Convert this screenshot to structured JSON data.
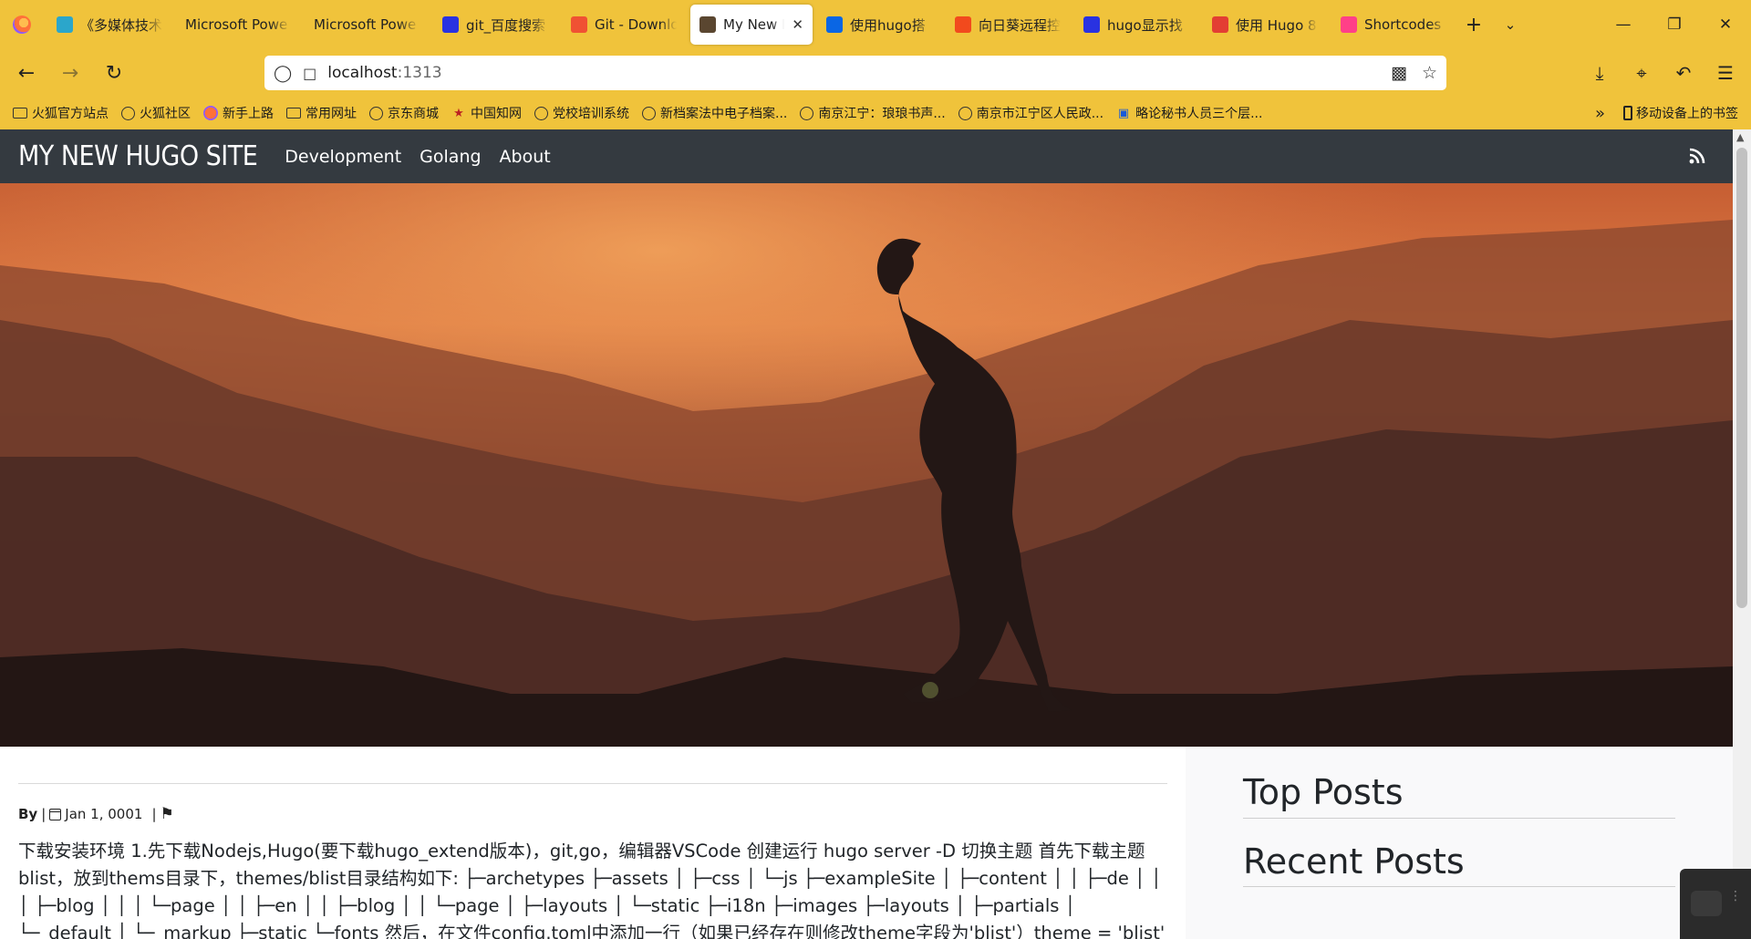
{
  "browser": {
    "tabs": [
      {
        "label": "《多媒体技术",
        "icon": "teal-logo-icon",
        "color": "#2ba6cb"
      },
      {
        "label": "Microsoft Powe",
        "icon": "",
        "color": ""
      },
      {
        "label": "Microsoft Powe",
        "icon": "",
        "color": ""
      },
      {
        "label": "git_百度搜索",
        "icon": "baidu-icon",
        "color": "#2932e1"
      },
      {
        "label": "Git - Downlo",
        "icon": "git-icon",
        "color": "#f05133"
      },
      {
        "label": "My New H",
        "icon": "page-thumbnail-icon",
        "color": "#5a4630",
        "active": true
      },
      {
        "label": "使用hugo搭",
        "icon": "zhihu-icon",
        "color": "#0a66e4"
      },
      {
        "label": "向日葵远程控",
        "icon": "sunflower-icon",
        "color": "#f24a1d"
      },
      {
        "label": "hugo显示找",
        "icon": "baidu-icon",
        "color": "#2932e1"
      },
      {
        "label": "使用 Hugo 8",
        "icon": "csdn-icon",
        "color": "#e33e33"
      },
      {
        "label": "Shortcodes",
        "icon": "hugo-icon",
        "color": "#ff4088"
      }
    ],
    "url_host": "localhost",
    "url_port": ":1313",
    "bookmarks": [
      {
        "label": "火狐官方站点",
        "icon": "folder"
      },
      {
        "label": "火狐社区",
        "icon": "globe"
      },
      {
        "label": "新手上路",
        "icon": "firefox"
      },
      {
        "label": "常用网址",
        "icon": "folder"
      },
      {
        "label": "京东商城",
        "icon": "globe"
      },
      {
        "label": "中国知网",
        "icon": "cnki"
      },
      {
        "label": "党校培训系统",
        "icon": "globe"
      },
      {
        "label": "新档案法中电子档案...",
        "icon": "globe"
      },
      {
        "label": "南京江宁：琅琅书声...",
        "icon": "globe"
      },
      {
        "label": "南京市江宁区人民政...",
        "icon": "globe"
      },
      {
        "label": "略论秘书人员三个层...",
        "icon": "blue"
      }
    ],
    "mobile_bookmarks": "移动设备上的书签"
  },
  "site": {
    "title": "MY NEW HUGO SITE",
    "nav": [
      "Development",
      "Golang",
      "About"
    ],
    "post": {
      "by": "By",
      "sep1": "|",
      "date": "Jan 1, 0001",
      "sep2": "|",
      "excerpt": "下载安装环境 1.先下载Nodejs,Hugo(要下载hugo_extend版本)，git,go，编辑器VSCode 创建运行 hugo server -D 切换主题 首先下载主题blist，放到thems目录下，themes/blist目录结构如下: ├─archetypes ├─assets │ ├─css │ └─js ├─exampleSite │ ├─content │ │ ├─de │ │ │ ├─blog │ │ │ └─page │ │ ├─en │ │ ├─blog │ │ └─page │ ├─layouts │ └─static ├─i18n ├─images ├─layouts │ ├─partials │ └─_default │ └─_markup ├─static └─fonts 然后，在文件config.toml中添加一行（如果已经存在则修改theme字段为'blist'）theme = 'blist' 重新执行hugo"
    },
    "sidebar": {
      "top_posts": "Top Posts",
      "recent_posts": "Recent Posts"
    }
  }
}
